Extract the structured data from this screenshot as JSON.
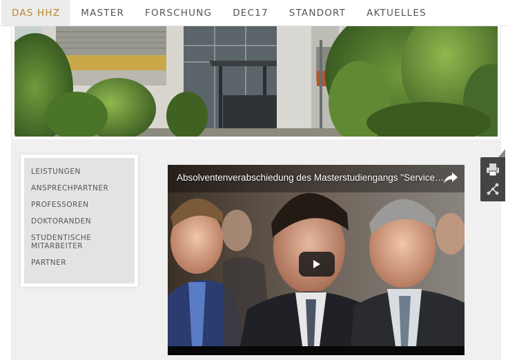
{
  "nav": {
    "items": [
      {
        "label": "DAS HHZ",
        "active": true
      },
      {
        "label": "MASTER",
        "active": false
      },
      {
        "label": "FORSCHUNG",
        "active": false
      },
      {
        "label": "DEC17",
        "active": false
      },
      {
        "label": "STANDORT",
        "active": false
      },
      {
        "label": "AKTUELLES",
        "active": false
      }
    ]
  },
  "subnav": {
    "items": [
      {
        "label": "LEISTUNGEN"
      },
      {
        "label": "ANSPRECHPARTNER"
      },
      {
        "label": "PROFESSOREN"
      },
      {
        "label": "DOKTORANDEN"
      },
      {
        "label": "STUDENTISCHE MITARBEITER"
      },
      {
        "label": "PARTNER"
      }
    ]
  },
  "video": {
    "title": "Absolventenverabschiedung des Masterstudiengangs \"Services Computing\"",
    "play_icon": "play-icon",
    "share_icon": "share-icon"
  },
  "tools": {
    "print_icon": "print-icon",
    "share_icon": "share-nodes-icon"
  },
  "colors": {
    "accent": "#b8872c",
    "nav_active_bg": "#ececec",
    "page_bg": "#f0f0f0",
    "subnav_bg": "#e3e3e3",
    "tools_bg": "#444444"
  }
}
